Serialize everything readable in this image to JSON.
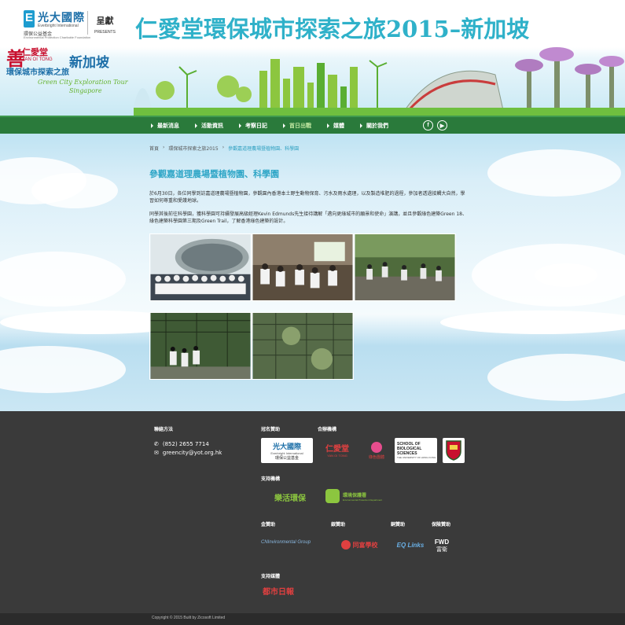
{
  "header": {
    "sponsor_cn": "光大國際",
    "sponsor_en": "Everbright International",
    "sponsor_sub_cn": "環保公益基金",
    "sponsor_sub_en": "Environmental Protection Charitable Foundation",
    "presents_cn": "呈獻",
    "presents_en": "PRESENTS",
    "main_title": "仁愛堂環保城市探索之旅2015–新加坡",
    "yot_cn": "仁愛堂",
    "yot_en": "YAN OI TONG",
    "campaign_cn": "環保城市探索之旅",
    "campaign_sg": "新加坡",
    "campaign_en1": "Green City Exploration Tour",
    "campaign_en2": "Singapore"
  },
  "nav": {
    "items": [
      {
        "label": "最新消息",
        "active": false
      },
      {
        "label": "活動資訊",
        "active": false
      },
      {
        "label": "考察日記",
        "active": false
      },
      {
        "label": "首日出戰",
        "active": true
      },
      {
        "label": "媒體",
        "active": false
      },
      {
        "label": "關於我們",
        "active": false
      }
    ],
    "social": [
      {
        "icon": "facebook-icon",
        "glyph": "f"
      },
      {
        "icon": "youtube-icon",
        "glyph": "▶"
      }
    ]
  },
  "breadcrumb": {
    "home": "首頁",
    "section": "環保城市探索之旅2015",
    "current": "參觀嘉道理農場暨植物園、科學園"
  },
  "article": {
    "title": "參觀嘉道理農場暨植物園、科學園",
    "para1": "於6月30日，各位同學到訪嘉道理農場暨植物園，參觀園內香港本土野生動物保育、污水及雨水處理，以及製造堆肥的過程，參加者透過接觸大自然，學習如何尊重和愛護地球。",
    "para2": "同學其後前往科學園，獲科學園可持續發展高級經理Kevin Edmunds先生接待講解「邁向更綠城市的願景和使命」演講，並且參觀綠色建築Green 18、綠色建築科學園第三期及Green Trail，了解香港綠色建築的設計。"
  },
  "footer": {
    "contact_heading": "聯絡方法",
    "phone": "(852) 2655 7714",
    "email": "greencity@yot.org.hk",
    "title_sponsor_heading": "冠名贊助",
    "organiser_heading": "合辦機構",
    "support_heading": "支持機構",
    "gold_heading": "金贊助",
    "silver_heading": "銀贊助",
    "bronze_heading": "銅贊助",
    "insurance_heading": "保險贊助",
    "media_heading": "支持媒體",
    "logos": {
      "eb_cn": "光大國際",
      "eb_en": "Everbright International",
      "eb_sub": "環保公益基金",
      "yot_cn": "仁愛堂",
      "yot_en": "YAN OI TONG",
      "green_org": "綠色團體",
      "hku_l1": "SCHOOL OF",
      "hku_l2": "BIOLOGICAL",
      "hku_l3": "SCIENCES",
      "hku_l4": "THE UNIVERSITY OF HONG KONG",
      "eco_cn": "樂活環保",
      "epd_cn": "環境保護署",
      "epd_en": "Environmental Protection Department",
      "cn_env": "CNInvironmental Group",
      "school": "同富學校",
      "bronze": "EQ Links",
      "fwd_en": "FWD",
      "fwd_cn": "富衛",
      "media": "都市日報"
    },
    "copyright": "Copyright © 2015 Built by Zicosoft Limited"
  },
  "colors": {
    "title_teal": "#2fb1c9",
    "nav_green": "#2a7a3b",
    "footer_bg": "#3a3a3a",
    "brand_red": "#c8102e"
  }
}
